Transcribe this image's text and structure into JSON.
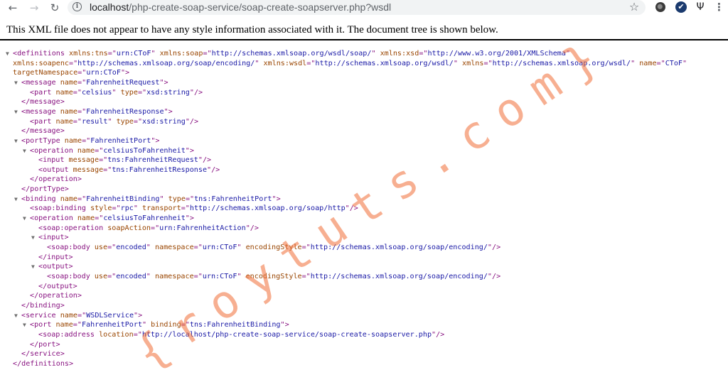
{
  "browser": {
    "back_icon": "←",
    "forward_icon": "→",
    "reload_icon": "↻",
    "info_icon": "i",
    "url_host": "localhost",
    "url_path": "/php-create-soap-service/soap-create-soapserver.php?wsdl",
    "star_icon": "☆",
    "ext2_icon": "✔",
    "ext3_icon": "Ψ",
    "menu_icon": "⋮"
  },
  "page": {
    "info_message": "This XML file does not appear to have any style information associated with it. The document tree is shown below.",
    "xml_lines": [
      {
        "t": "▼",
        "x": 18,
        "parts": [
          [
            "tag",
            "<definitions "
          ],
          [
            "an",
            "xmlns:tns"
          ],
          [
            "tag",
            "=\""
          ],
          [
            "av",
            "urn:CToF"
          ],
          [
            "tag",
            "\" "
          ],
          [
            "an",
            "xmlns:soap"
          ],
          [
            "tag",
            "=\""
          ],
          [
            "av",
            "http://schemas.xmlsoap.org/wsdl/soap/"
          ],
          [
            "tag",
            "\" "
          ],
          [
            "an",
            "xmlns:xsd"
          ],
          [
            "tag",
            "=\""
          ],
          [
            "av",
            "http://www.w3.org/2001/XMLSchema"
          ],
          [
            "tag",
            "\""
          ]
        ]
      },
      {
        "t": "",
        "x": 18,
        "parts": [
          [
            "an",
            "xmlns:soapenc"
          ],
          [
            "tag",
            "=\""
          ],
          [
            "av",
            "http://schemas.xmlsoap.org/soap/encoding/"
          ],
          [
            "tag",
            "\" "
          ],
          [
            "an",
            "xmlns:wsdl"
          ],
          [
            "tag",
            "=\""
          ],
          [
            "av",
            "http://schemas.xmlsoap.org/wsdl/"
          ],
          [
            "tag",
            "\" "
          ],
          [
            "an",
            "xmlns"
          ],
          [
            "tag",
            "=\""
          ],
          [
            "av",
            "http://schemas.xmlsoap.org/wsdl/"
          ],
          [
            "tag",
            "\" "
          ],
          [
            "an",
            "name"
          ],
          [
            "tag",
            "=\""
          ],
          [
            "av",
            "CToF"
          ],
          [
            "tag",
            "\""
          ]
        ]
      },
      {
        "t": "",
        "x": 18,
        "parts": [
          [
            "an",
            "targetNamespace"
          ],
          [
            "tag",
            "=\""
          ],
          [
            "av",
            "urn:CToF"
          ],
          [
            "tag",
            "\">"
          ]
        ]
      },
      {
        "t": "▼",
        "x": 30,
        "parts": [
          [
            "tag",
            "<message "
          ],
          [
            "an",
            "name"
          ],
          [
            "tag",
            "=\""
          ],
          [
            "av",
            "FahrenheitRequest"
          ],
          [
            "tag",
            "\">"
          ]
        ]
      },
      {
        "t": "",
        "x": 42,
        "parts": [
          [
            "tag",
            "<part "
          ],
          [
            "an",
            "name"
          ],
          [
            "tag",
            "=\""
          ],
          [
            "av",
            "celsius"
          ],
          [
            "tag",
            "\" "
          ],
          [
            "an",
            "type"
          ],
          [
            "tag",
            "=\""
          ],
          [
            "av",
            "xsd:string"
          ],
          [
            "tag",
            "\"/>"
          ]
        ]
      },
      {
        "t": "",
        "x": 30,
        "parts": [
          [
            "tag",
            "</message>"
          ]
        ]
      },
      {
        "t": "▼",
        "x": 30,
        "parts": [
          [
            "tag",
            "<message "
          ],
          [
            "an",
            "name"
          ],
          [
            "tag",
            "=\""
          ],
          [
            "av",
            "FahrenheitResponse"
          ],
          [
            "tag",
            "\">"
          ]
        ]
      },
      {
        "t": "",
        "x": 42,
        "parts": [
          [
            "tag",
            "<part "
          ],
          [
            "an",
            "name"
          ],
          [
            "tag",
            "=\""
          ],
          [
            "av",
            "result"
          ],
          [
            "tag",
            "\" "
          ],
          [
            "an",
            "type"
          ],
          [
            "tag",
            "=\""
          ],
          [
            "av",
            "xsd:string"
          ],
          [
            "tag",
            "\"/>"
          ]
        ]
      },
      {
        "t": "",
        "x": 30,
        "parts": [
          [
            "tag",
            "</message>"
          ]
        ]
      },
      {
        "t": "▼",
        "x": 30,
        "parts": [
          [
            "tag",
            "<portType "
          ],
          [
            "an",
            "name"
          ],
          [
            "tag",
            "=\""
          ],
          [
            "av",
            "FahrenheitPort"
          ],
          [
            "tag",
            "\">"
          ]
        ]
      },
      {
        "t": "▼",
        "x": 42,
        "parts": [
          [
            "tag",
            "<operation "
          ],
          [
            "an",
            "name"
          ],
          [
            "tag",
            "=\""
          ],
          [
            "av",
            "celsiusToFahrenheit"
          ],
          [
            "tag",
            "\">"
          ]
        ]
      },
      {
        "t": "",
        "x": 54,
        "parts": [
          [
            "tag",
            "<input "
          ],
          [
            "an",
            "message"
          ],
          [
            "tag",
            "=\""
          ],
          [
            "av",
            "tns:FahrenheitRequest"
          ],
          [
            "tag",
            "\"/>"
          ]
        ]
      },
      {
        "t": "",
        "x": 54,
        "parts": [
          [
            "tag",
            "<output "
          ],
          [
            "an",
            "message"
          ],
          [
            "tag",
            "=\""
          ],
          [
            "av",
            "tns:FahrenheitResponse"
          ],
          [
            "tag",
            "\"/>"
          ]
        ]
      },
      {
        "t": "",
        "x": 42,
        "parts": [
          [
            "tag",
            "</operation>"
          ]
        ]
      },
      {
        "t": "",
        "x": 30,
        "parts": [
          [
            "tag",
            "</portType>"
          ]
        ]
      },
      {
        "t": "▼",
        "x": 30,
        "parts": [
          [
            "tag",
            "<binding "
          ],
          [
            "an",
            "name"
          ],
          [
            "tag",
            "=\""
          ],
          [
            "av",
            "FahrenheitBinding"
          ],
          [
            "tag",
            "\" "
          ],
          [
            "an",
            "type"
          ],
          [
            "tag",
            "=\""
          ],
          [
            "av",
            "tns:FahrenheitPort"
          ],
          [
            "tag",
            "\">"
          ]
        ]
      },
      {
        "t": "",
        "x": 42,
        "parts": [
          [
            "tag",
            "<soap:binding "
          ],
          [
            "an",
            "style"
          ],
          [
            "tag",
            "=\""
          ],
          [
            "av",
            "rpc"
          ],
          [
            "tag",
            "\" "
          ],
          [
            "an",
            "transport"
          ],
          [
            "tag",
            "=\""
          ],
          [
            "av",
            "http://schemas.xmlsoap.org/soap/http"
          ],
          [
            "tag",
            "\"/>"
          ]
        ]
      },
      {
        "t": "▼",
        "x": 42,
        "parts": [
          [
            "tag",
            "<operation "
          ],
          [
            "an",
            "name"
          ],
          [
            "tag",
            "=\""
          ],
          [
            "av",
            "celsiusToFahrenheit"
          ],
          [
            "tag",
            "\">"
          ]
        ]
      },
      {
        "t": "",
        "x": 54,
        "parts": [
          [
            "tag",
            "<soap:operation "
          ],
          [
            "an",
            "soapAction"
          ],
          [
            "tag",
            "=\""
          ],
          [
            "av",
            "urn:FahrenheitAction"
          ],
          [
            "tag",
            "\"/>"
          ]
        ]
      },
      {
        "t": "▼",
        "x": 54,
        "parts": [
          [
            "tag",
            "<input>"
          ]
        ]
      },
      {
        "t": "",
        "x": 66,
        "parts": [
          [
            "tag",
            "<soap:body "
          ],
          [
            "an",
            "use"
          ],
          [
            "tag",
            "=\""
          ],
          [
            "av",
            "encoded"
          ],
          [
            "tag",
            "\" "
          ],
          [
            "an",
            "namespace"
          ],
          [
            "tag",
            "=\""
          ],
          [
            "av",
            "urn:CToF"
          ],
          [
            "tag",
            "\" "
          ],
          [
            "an",
            "encodingStyle"
          ],
          [
            "tag",
            "=\""
          ],
          [
            "av",
            "http://schemas.xmlsoap.org/soap/encoding/"
          ],
          [
            "tag",
            "\"/>"
          ]
        ]
      },
      {
        "t": "",
        "x": 54,
        "parts": [
          [
            "tag",
            "</input>"
          ]
        ]
      },
      {
        "t": "▼",
        "x": 54,
        "parts": [
          [
            "tag",
            "<output>"
          ]
        ]
      },
      {
        "t": "",
        "x": 66,
        "parts": [
          [
            "tag",
            "<soap:body "
          ],
          [
            "an",
            "use"
          ],
          [
            "tag",
            "=\""
          ],
          [
            "av",
            "encoded"
          ],
          [
            "tag",
            "\" "
          ],
          [
            "an",
            "namespace"
          ],
          [
            "tag",
            "=\""
          ],
          [
            "av",
            "urn:CToF"
          ],
          [
            "tag",
            "\" "
          ],
          [
            "an",
            "encodingStyle"
          ],
          [
            "tag",
            "=\""
          ],
          [
            "av",
            "http://schemas.xmlsoap.org/soap/encoding/"
          ],
          [
            "tag",
            "\"/>"
          ]
        ]
      },
      {
        "t": "",
        "x": 54,
        "parts": [
          [
            "tag",
            "</output>"
          ]
        ]
      },
      {
        "t": "",
        "x": 42,
        "parts": [
          [
            "tag",
            "</operation>"
          ]
        ]
      },
      {
        "t": "",
        "x": 30,
        "parts": [
          [
            "tag",
            "</binding>"
          ]
        ]
      },
      {
        "t": "▼",
        "x": 30,
        "parts": [
          [
            "tag",
            "<service "
          ],
          [
            "an",
            "name"
          ],
          [
            "tag",
            "=\""
          ],
          [
            "av",
            "WSDLService"
          ],
          [
            "tag",
            "\">"
          ]
        ]
      },
      {
        "t": "▼",
        "x": 42,
        "parts": [
          [
            "tag",
            "<port "
          ],
          [
            "an",
            "name"
          ],
          [
            "tag",
            "=\""
          ],
          [
            "av",
            "FahrenheitPort"
          ],
          [
            "tag",
            "\" "
          ],
          [
            "an",
            "binding"
          ],
          [
            "tag",
            "=\""
          ],
          [
            "av",
            "tns:FahrenheitBinding"
          ],
          [
            "tag",
            "\">"
          ]
        ]
      },
      {
        "t": "",
        "x": 54,
        "parts": [
          [
            "tag",
            "<soap:address "
          ],
          [
            "an",
            "location"
          ],
          [
            "tag",
            "=\""
          ],
          [
            "av",
            "http://localhost/php-create-soap-service/soap-create-soapserver.php"
          ],
          [
            "tag",
            "\"/>"
          ]
        ]
      },
      {
        "t": "",
        "x": 42,
        "parts": [
          [
            "tag",
            "</port>"
          ]
        ]
      },
      {
        "t": "",
        "x": 30,
        "parts": [
          [
            "tag",
            "</service>"
          ]
        ]
      },
      {
        "t": "",
        "x": 18,
        "parts": [
          [
            "tag",
            "</definitions>"
          ]
        ]
      }
    ]
  },
  "watermark": {
    "text": "{roytuts.com}",
    "color": "#f06e37"
  }
}
